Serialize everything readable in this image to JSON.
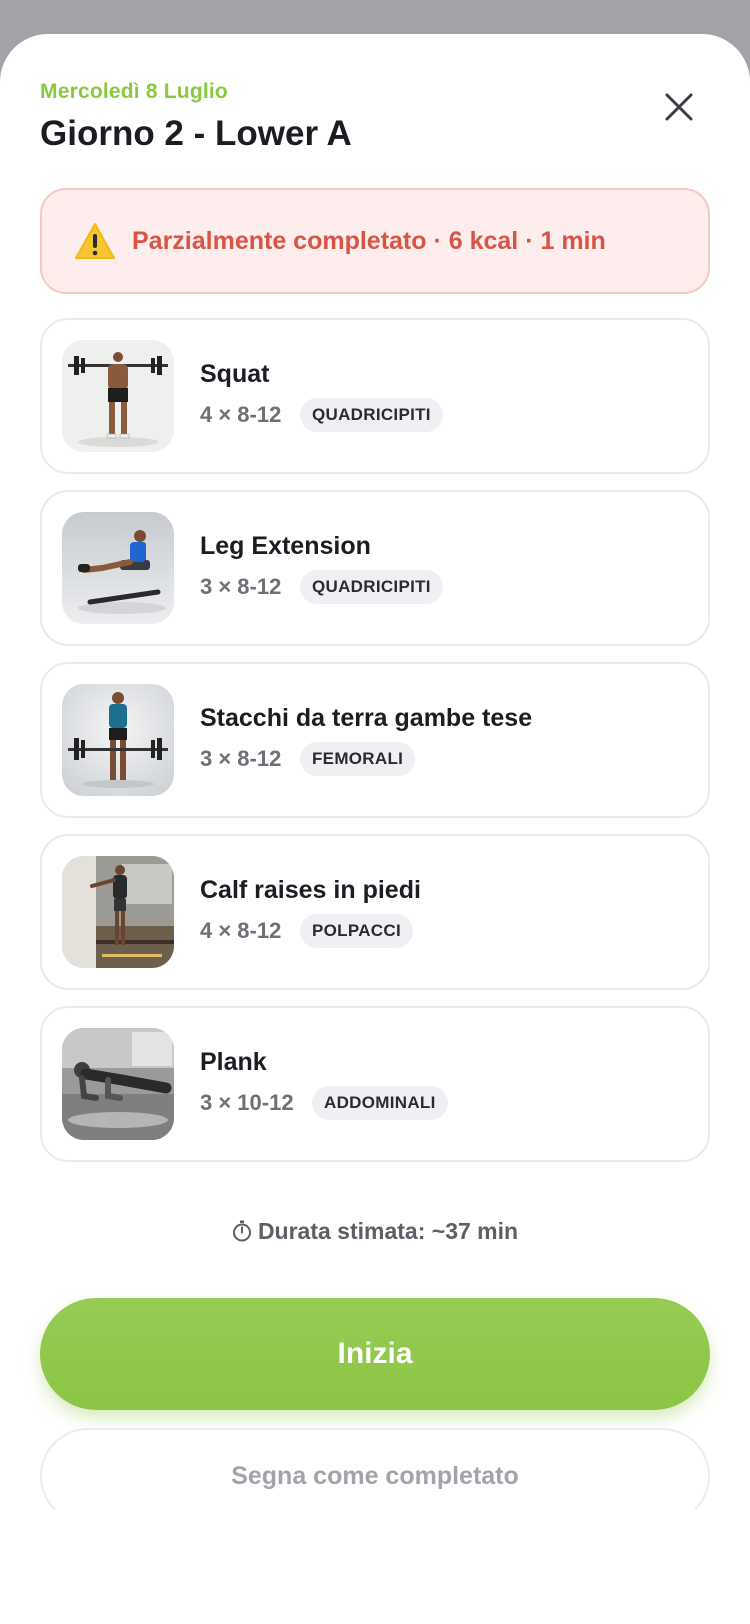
{
  "header": {
    "date": "Mercoledì 8 Luglio",
    "title": "Giorno 2 - Lower A"
  },
  "alert": {
    "icon": "warning-icon",
    "text": "Parzialmente completato · 6 kcal · 1 min",
    "color": "#d85546"
  },
  "exercises": [
    {
      "name": "Squat",
      "sets": "4 × 8-12",
      "tag": "QUADRICIPITI"
    },
    {
      "name": "Leg Extension",
      "sets": "3 × 8-12",
      "tag": "QUADRICIPITI"
    },
    {
      "name": "Stacchi da terra gambe tese",
      "sets": "3 × 8-12",
      "tag": "FEMORALI"
    },
    {
      "name": "Calf raises in piedi",
      "sets": "4 × 8-12",
      "tag": "POLPACCI"
    },
    {
      "name": "Plank",
      "sets": "3 × 10-12",
      "tag": "ADDOMINALI"
    }
  ],
  "footer": {
    "duration": "Durata stimata: ~37 min",
    "start_label": "Inizia",
    "complete_label": "Segna come completato"
  },
  "colors": {
    "accent": "#8cc545",
    "warning": "#d85546"
  }
}
